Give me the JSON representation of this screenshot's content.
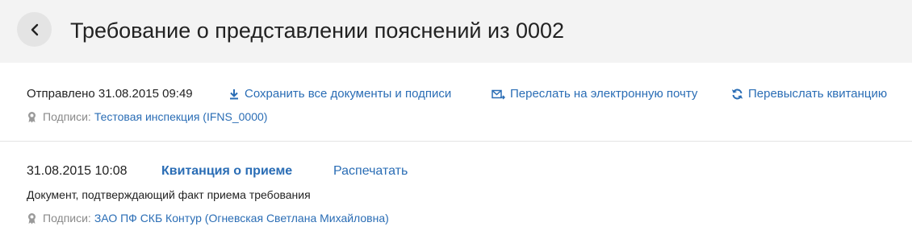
{
  "header": {
    "title": "Требование о представлении пояснений из 0002",
    "back_icon": "chevron-left-icon"
  },
  "sent_section": {
    "sent_text": "Отправлено 31.08.2015 09:49",
    "actions": {
      "save_all": {
        "label": "Сохранить все документы и подписи",
        "icon": "download-icon"
      },
      "forward_email": {
        "label": "Переслать на электронную почту",
        "icon": "mail-forward-icon"
      },
      "resend_receipt": {
        "label": "Перевыслать квитанцию",
        "icon": "refresh-icon"
      }
    },
    "signatures": {
      "label": "Подписи:",
      "value": "Тестовая инспекция (IFNS_0000)",
      "icon": "seal-icon"
    }
  },
  "receipt_section": {
    "date": "31.08.2015 10:08",
    "link_label": "Квитанция о приеме",
    "print_label": "Распечатать",
    "description": "Документ, подтверждающий факт приема требования",
    "signatures": {
      "label": "Подписи:",
      "value": "ЗАО ПФ СКБ Контур (Огневская Светлана Михайловна)",
      "icon": "seal-icon"
    }
  },
  "colors": {
    "link": "#2a6db5",
    "header_bg": "#f3f3f3",
    "muted": "#8a8a8a"
  }
}
